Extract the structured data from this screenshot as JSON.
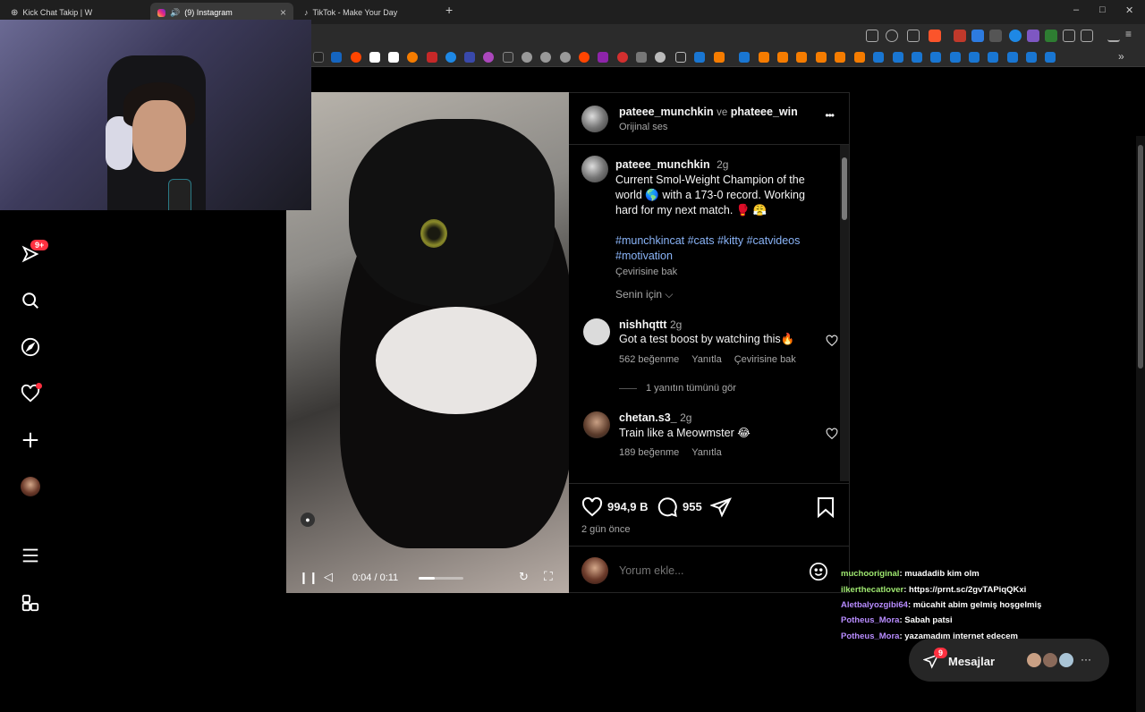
{
  "browser": {
    "tabs": [
      {
        "title": "Kick Chat Takip | W"
      },
      {
        "title": "(9) Instagram"
      },
      {
        "title": "TikTok - Make Your Day"
      }
    ],
    "new_tab": "+",
    "window": {
      "minimize": "–",
      "maximize": "□",
      "close": "✕"
    }
  },
  "sidebar": {
    "notification_badge": "9+"
  },
  "video": {
    "time": "0:04 / 0:11",
    "progress_fraction": 0.36
  },
  "post": {
    "header_user1": "pateee_munchkin",
    "header_joiner": "ve",
    "header_user2": "phateee_win",
    "audio": "Orijinal ses",
    "more": "•••",
    "author": "pateee_munchkin",
    "age": "2g",
    "caption": "Current Smol-Weight Champion of the world 🌎 with a 173-0 record. Working hard for my next match. 🥊 😤",
    "hashtags": "#munchkincat #cats #kitty #catvideos #motivation",
    "translate": "Çevirisine bak",
    "for_you": "Senin için",
    "likes": "994,9 B",
    "comments_count": "955",
    "date": "2 gün önce",
    "add_comment_placeholder": "Yorum ekle..."
  },
  "comments": [
    {
      "user": "nishhqttt",
      "age": "2g",
      "text": "Got a test boost by watching this🔥",
      "likes": "562 beğenme",
      "reply": "Yanıtla",
      "translate": "Çevirisine bak",
      "view_replies": "1 yanıtın tümünü gör"
    },
    {
      "user": "chetan.s3_",
      "age": "2g",
      "text": "Train like a Meowmster 😂",
      "likes": "189 beğenme",
      "reply": "Yanıtla"
    }
  ],
  "messages": {
    "label": "Mesajlar",
    "badge": "9",
    "more": "···"
  },
  "chat": [
    {
      "user": "muchooriginal",
      "msg": ": muadadib kim olm",
      "color": "#9fe870"
    },
    {
      "user": "ilkerthecatlover",
      "msg": ": https://prnt.sc/2gvTAPiqQKxi",
      "color": "#9fe870"
    },
    {
      "user": "Aletbalyozgibi64",
      "msg": ": mücahit abim gelmiş hoşgelmiş",
      "color": "#b88cff"
    },
    {
      "user": "Potheus_Mora",
      "msg": ": Sabah patsi",
      "color": "#b88cff"
    },
    {
      "user": "Potheus_Mora",
      "msg": ": yazamadım internet edecem",
      "color": "#b88cff"
    }
  ],
  "colors": {
    "hashtag": "#8ab4f8",
    "badge": "#ff3040",
    "panel_bg": "#000000"
  }
}
